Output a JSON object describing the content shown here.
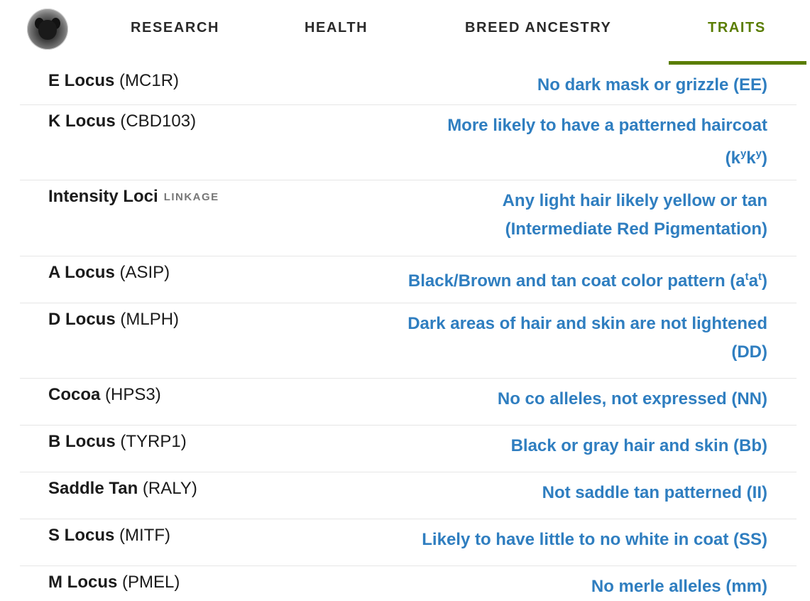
{
  "nav": {
    "avatar_alt": "dog profile photo",
    "tabs": [
      {
        "label": "RESEARCH",
        "active": false
      },
      {
        "label": "HEALTH",
        "active": false
      },
      {
        "label": "BREED ANCESTRY",
        "active": false
      },
      {
        "label": "TRAITS",
        "active": true
      }
    ],
    "active_color": "#5a7d00"
  },
  "traits": {
    "link_color": "#2f7ec0",
    "rows": [
      {
        "name": "E Locus",
        "gene": "(MC1R)",
        "badge": "",
        "result": "No dark mask or grizzle (EE)"
      },
      {
        "name": "K Locus",
        "gene": "(CBD103)",
        "badge": "",
        "result_line1": "More likely to have a patterned haircoat",
        "result_line2_pre": "(k",
        "sup1": "y",
        "mid": "k",
        "sup2": "y",
        "result_line2_post": ")"
      },
      {
        "name": "Intensity Loci",
        "gene": "",
        "badge": "LINKAGE",
        "result_line1": "Any light hair likely yellow or tan",
        "result_line2": "(Intermediate Red Pigmentation)"
      },
      {
        "name": "A Locus",
        "gene": "(ASIP)",
        "badge": "",
        "result_pre": "Black/Brown and tan coat color pattern (a",
        "sup1": "t",
        "mid": "a",
        "sup2": "t",
        "result_post": ")"
      },
      {
        "name": "D Locus",
        "gene": "(MLPH)",
        "badge": "",
        "result_line1": "Dark areas of hair and skin are not lightened",
        "result_line2": "(DD)"
      },
      {
        "name": "Cocoa",
        "gene": "(HPS3)",
        "badge": "",
        "result": "No co alleles, not expressed (NN)"
      },
      {
        "name": "B Locus",
        "gene": "(TYRP1)",
        "badge": "",
        "result": "Black or gray hair and skin (Bb)"
      },
      {
        "name": "Saddle Tan",
        "gene": "(RALY)",
        "badge": "",
        "result": "Not saddle tan patterned (II)"
      },
      {
        "name": "S Locus",
        "gene": "(MITF)",
        "badge": "",
        "result": "Likely to have little to no white in coat (SS)"
      },
      {
        "name": "M Locus",
        "gene": "(PMEL)",
        "badge": "",
        "result": "No merle alleles (mm)"
      }
    ]
  }
}
